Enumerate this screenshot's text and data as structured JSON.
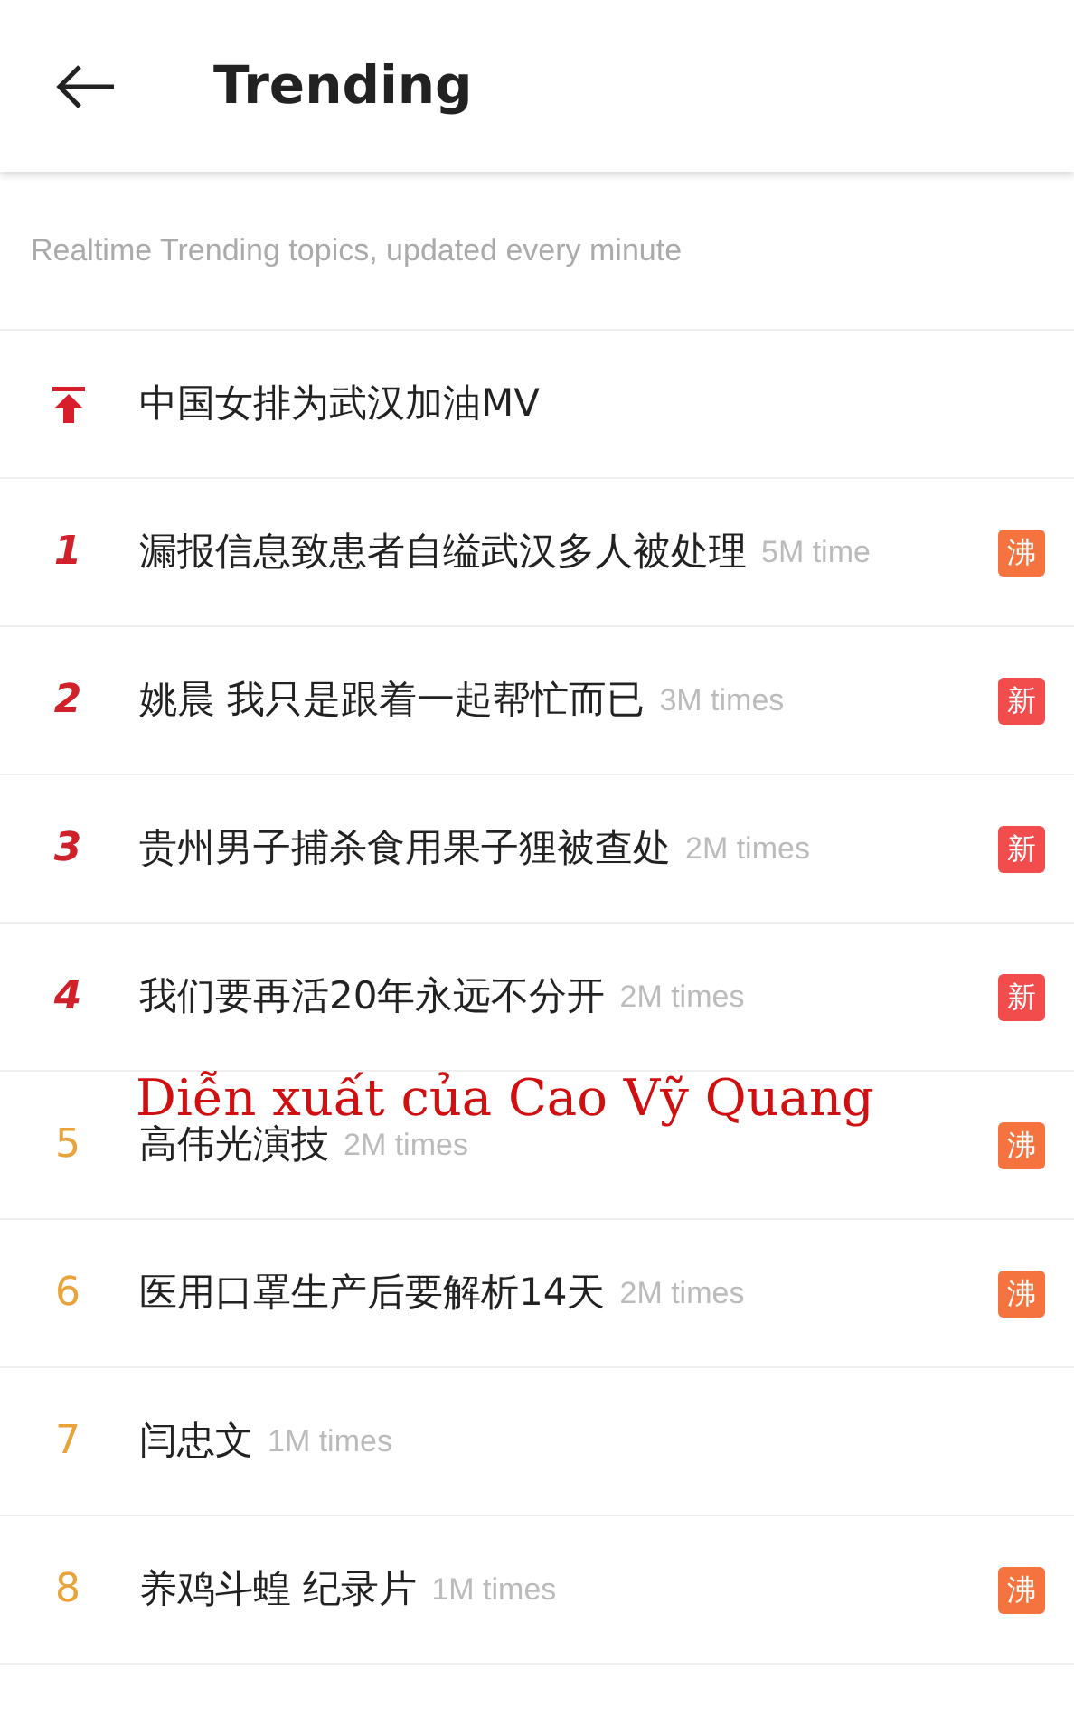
{
  "header": {
    "title": "Trending"
  },
  "subtitle": "Realtime Trending topics, updated every minute",
  "rows": [
    {
      "kind": "pinned",
      "title": "中国女排为武汉加油MV"
    },
    {
      "kind": "top",
      "rank": "1",
      "title": "漏报信息致患者自缢武汉多人被处理",
      "times": "5M time",
      "badge": {
        "text": "沸",
        "color": "#f4733f"
      }
    },
    {
      "kind": "top",
      "rank": "2",
      "title": "姚晨 我只是跟着一起帮忙而已",
      "times": "3M times",
      "badge": {
        "text": "新",
        "color": "#f24c4c"
      }
    },
    {
      "kind": "top",
      "rank": "3",
      "title": "贵州男子捕杀食用果子狸被查处",
      "times": "2M times",
      "badge": {
        "text": "新",
        "color": "#f24c4c"
      }
    },
    {
      "kind": "top",
      "rank": "4",
      "title": "我们要再活20年永远不分开",
      "times": "2M times",
      "badge": {
        "text": "新",
        "color": "#f24c4c"
      }
    },
    {
      "kind": "normal",
      "rank": "5",
      "title": "高伟光演技",
      "times": "2M times",
      "badge": {
        "text": "沸",
        "color": "#f4733f"
      },
      "annotation": "Diễn xuất của Cao Vỹ Quang"
    },
    {
      "kind": "normal",
      "rank": "6",
      "title": "医用口罩生产后要解析14天",
      "times": "2M times",
      "badge": {
        "text": "沸",
        "color": "#f4733f"
      }
    },
    {
      "kind": "normal",
      "rank": "7",
      "title": "闫忠文",
      "times": "1M times"
    },
    {
      "kind": "normal",
      "rank": "8",
      "title": "养鸡斗蝗 纪录片",
      "times": "1M times",
      "badge": {
        "text": "沸",
        "color": "#f4733f"
      }
    }
  ]
}
